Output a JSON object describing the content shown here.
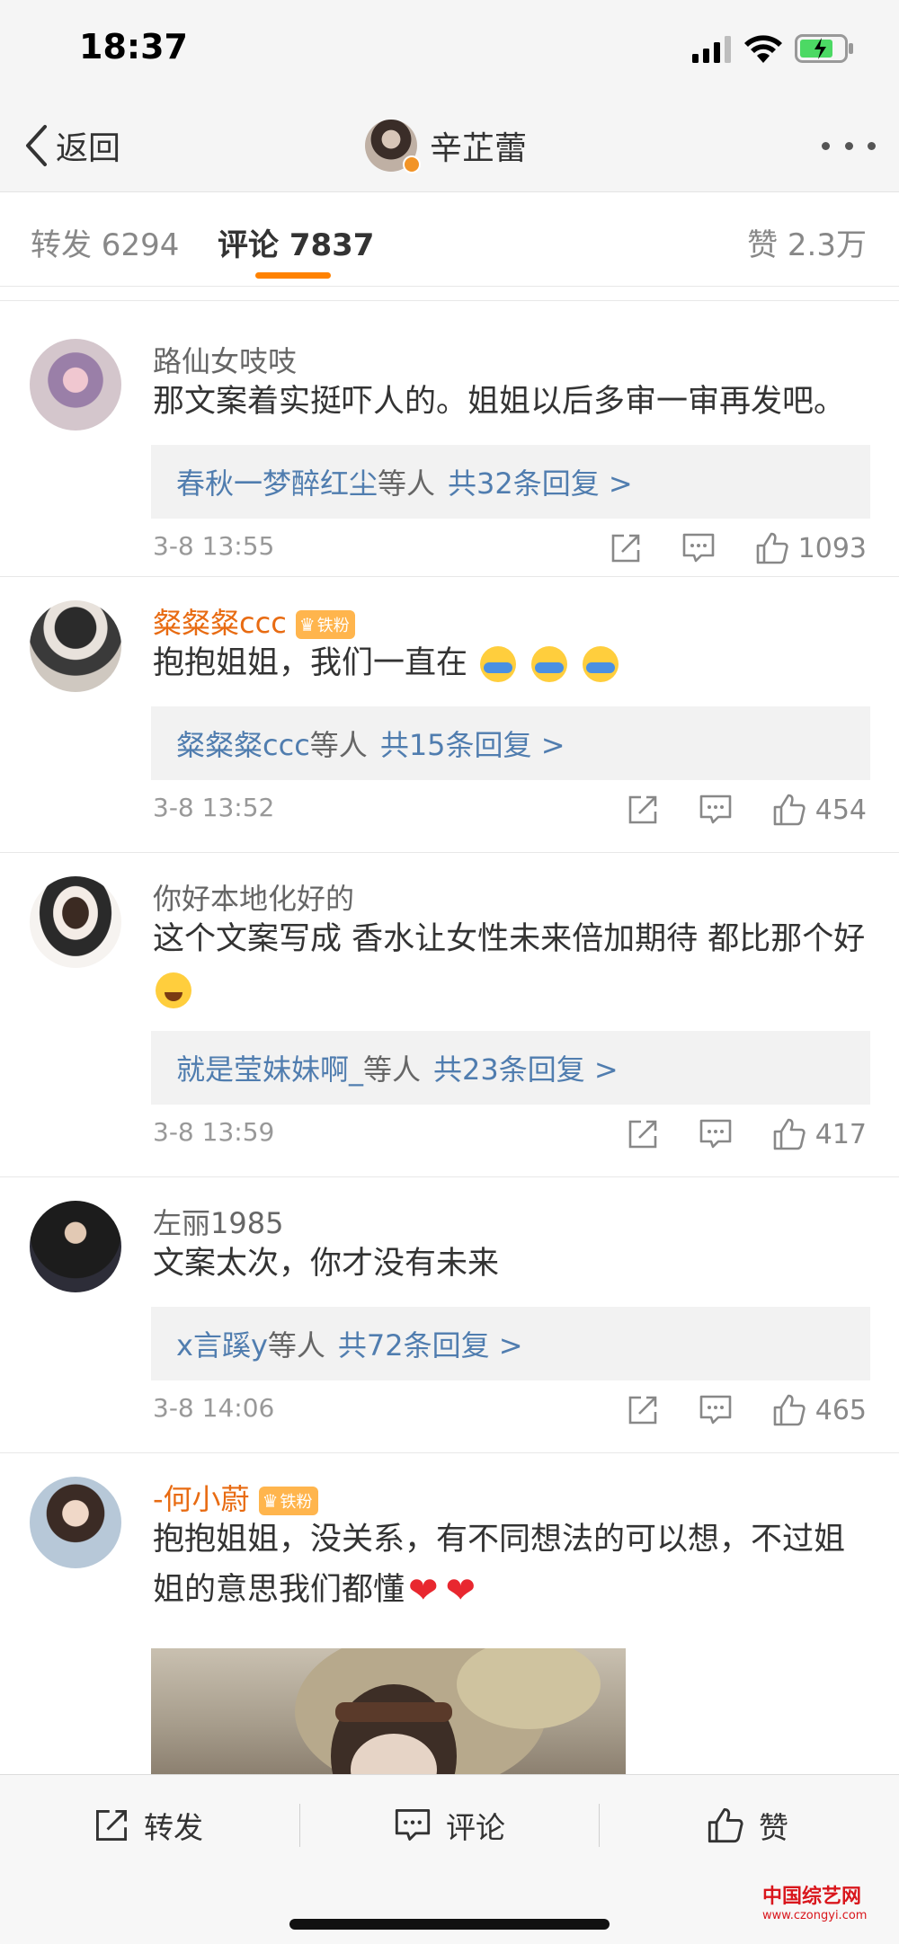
{
  "status_bar": {
    "time": "18:37"
  },
  "nav": {
    "back_label": "返回",
    "title": "辛芷蕾"
  },
  "tabs": {
    "repost": "转发 6294",
    "comments": "评论 7837",
    "likes": "赞 2.3万"
  },
  "comments": [
    {
      "name": "路仙女吱吱",
      "text": "那文案着实挺吓人的。姐姐以后多审一审再发吧。",
      "reply_who": "春秋一梦醉红尘",
      "reply_suffix": "等人",
      "reply_count": "共32条回复 >",
      "time": "3-8 13:55",
      "likes": "1093"
    },
    {
      "name": "粲粲粲ccc",
      "badge": "铁粉",
      "text": "抱抱姐姐，我们一直在",
      "reply_who": "粲粲粲ccc",
      "reply_suffix": "等人",
      "reply_count": "共15条回复 >",
      "time": "3-8 13:52",
      "likes": "454"
    },
    {
      "name": "你好本地化好的",
      "text": "这个文案写成 香水让女性未来倍加期待  都比那个好",
      "reply_who": "就是莹妹妹啊_",
      "reply_suffix": "等人",
      "reply_count": "共23条回复 >",
      "time": "3-8 13:59",
      "likes": "417"
    },
    {
      "name": "左丽1985",
      "text": "文案太次，你才没有未来",
      "reply_who": "x言蹊y",
      "reply_suffix": "等人",
      "reply_count": "共72条回复 >",
      "time": "3-8 14:06",
      "likes": "465"
    },
    {
      "name": "-何小蔚",
      "badge": "铁粉",
      "text": "抱抱姐姐，没关系，有不同想法的可以想，不过姐姐的意思我们都懂"
    }
  ],
  "toolbar": {
    "repost": "转发",
    "comment": "评论",
    "like": "赞"
  },
  "watermark": {
    "main": "中国综艺网",
    "sub": "www.czongyi.com"
  },
  "colors": {
    "accent": "#ff8200",
    "link": "#507daf",
    "username_highlight": "#e86b12",
    "badge": "#ffb54d"
  }
}
